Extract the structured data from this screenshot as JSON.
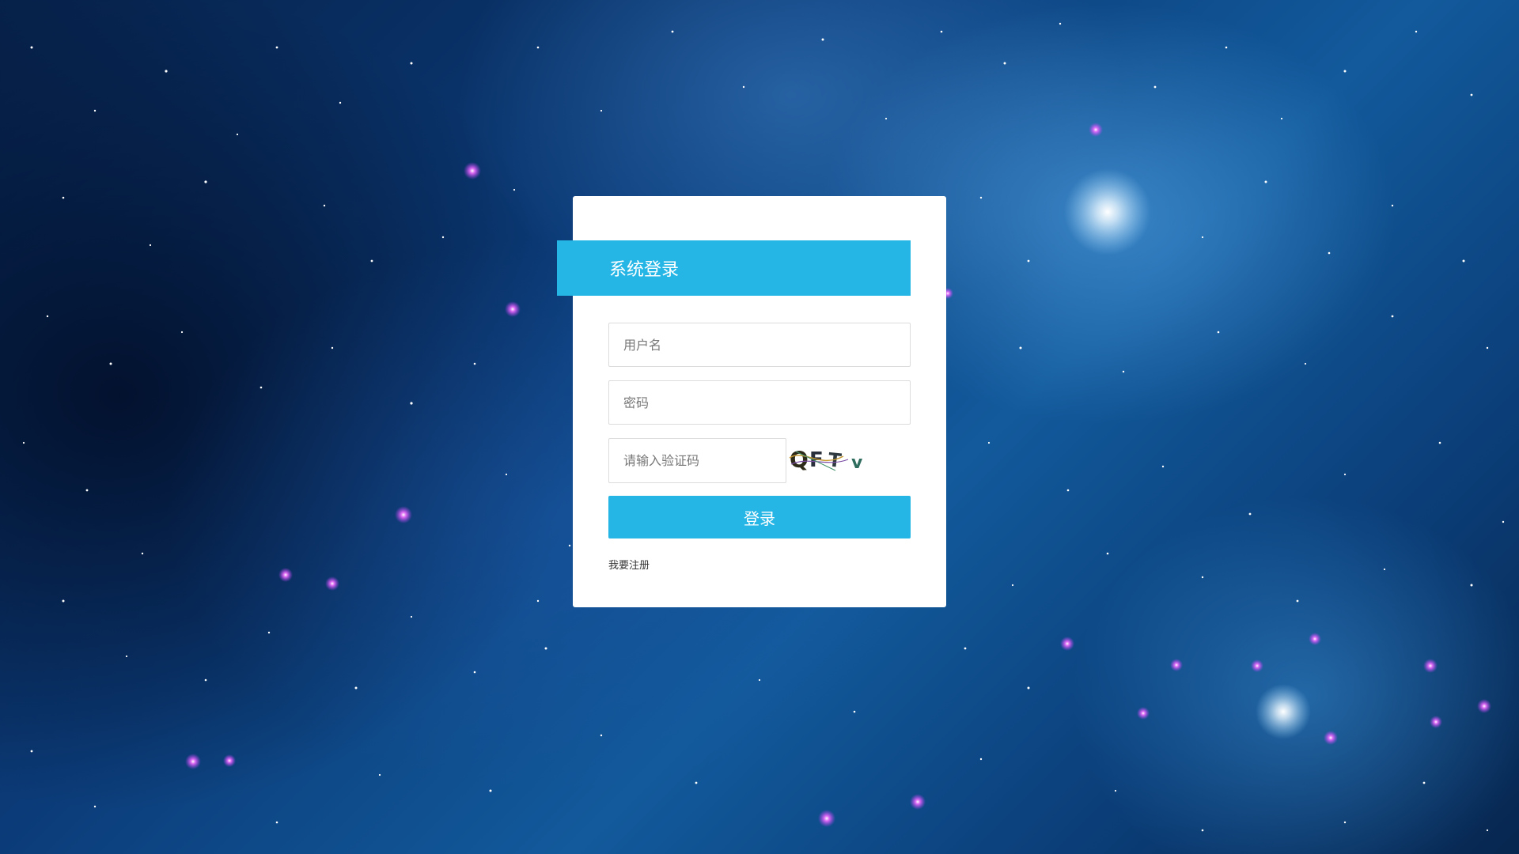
{
  "login": {
    "title": "系统登录",
    "username_placeholder": "用户名",
    "password_placeholder": "密码",
    "captcha_placeholder": "请输入验证码",
    "captcha_text": "QFTV",
    "submit_label": "登录",
    "register_label": "我要注册"
  },
  "colors": {
    "accent": "#26b6e6",
    "card_bg": "#ffffff"
  }
}
